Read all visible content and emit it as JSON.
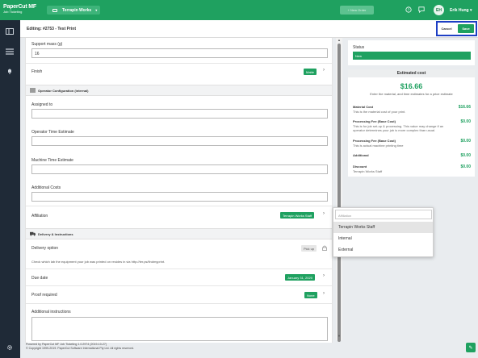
{
  "topbar": {
    "brand_line1": "PaperCut MF",
    "brand_line2": "Job Ticketing",
    "org_label": "Terrapin Works",
    "org_chevron": "▾",
    "new_order_label": "+ New Order",
    "user_initials": "EH",
    "user_name": "Erik Hung ▾"
  },
  "editing": {
    "title": "Editing: #2753  -  Test Print",
    "cancel_label": "Cancel",
    "save_label": "Save"
  },
  "form": {
    "support_mass_label": "Support mass (g)",
    "support_mass_value": "16",
    "finish_label": "Finish",
    "finish_value": "Matte",
    "operator_section": "Operator Configuration (internal)",
    "assigned_to_label": "Assigned to",
    "operator_time_label": "Operator Time Estimate",
    "machine_time_label": "Machine Time Estimate",
    "additional_costs_label": "Additional Costs",
    "affiliation_label": "Affiliation",
    "affiliation_value": "Terrapin Works Staff",
    "delivery_section": "Delivery & Instructions",
    "delivery_option_label": "Delivery option",
    "delivery_option_value": "Pick up",
    "delivery_note": "Check which lab the equipment your job was printed on resides in via http://ter.ps/findmyprint.",
    "due_date_label": "Due date",
    "due_date_value": "January 31, 2020",
    "proof_label": "Proof required",
    "proof_value": "None",
    "instructions_label": "Additional instructions"
  },
  "status": {
    "label": "Status",
    "value": "New"
  },
  "cost": {
    "header": "Estimated cost",
    "total": "$16.66",
    "note": "Enter the material, and time estimates for a price estimate",
    "rows": [
      {
        "title": "Material Cost",
        "desc": "This is the material cost of your print.",
        "value": "$16.66"
      },
      {
        "title": "Processing Fee (Base Cost)",
        "desc": "This is for job set-up & processing. This value may change if an operator determines your job is more complex than usual.",
        "value": "$0.00"
      },
      {
        "title": "Processing Fee (Base Cost)",
        "desc": "This is actual machine printing time",
        "value": "$0.00"
      },
      {
        "title": "Additional",
        "desc": "",
        "value": "$0.00"
      },
      {
        "title": "Discount",
        "desc": "Terrapin Works Staff",
        "value": "$0.00"
      }
    ]
  },
  "dropdown": {
    "placeholder": "Affiliation",
    "options": [
      "Terrapin Works Staff",
      "Internal",
      "External"
    ]
  },
  "footer": {
    "line1": "Powered by PaperCut MF Job Ticketing 1.0.2974 (2019-10-27)",
    "line2": "© Copyright 1999-2019. PaperCut Software International Pty Ltd. All rights reserved."
  },
  "colors": {
    "brand_green": "#1fa160",
    "sidebar": "#1f2a37",
    "highlight": "#1d3fc4"
  }
}
